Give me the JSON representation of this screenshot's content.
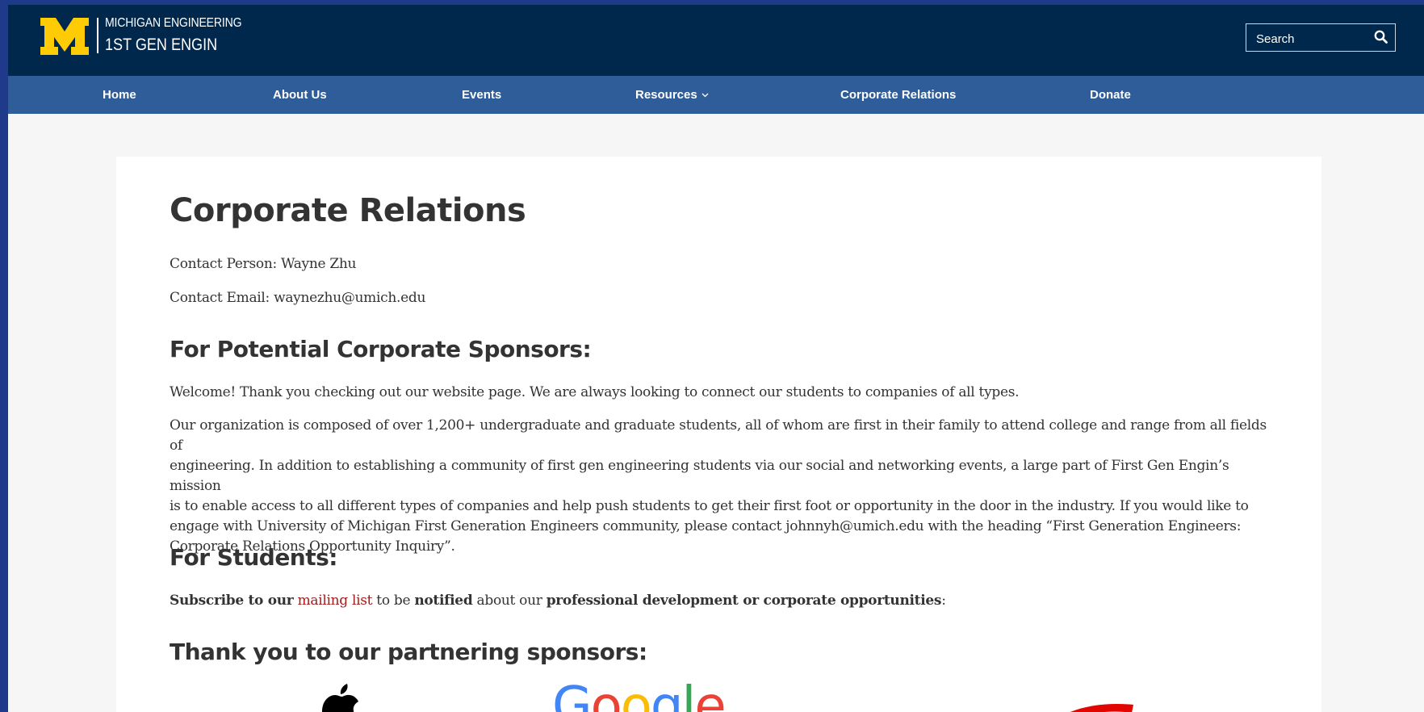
{
  "header": {
    "logo_top": "MICHIGAN ENGINEERING",
    "logo_bottom": "1ST GEN ENGIN",
    "search_placeholder": "Search",
    "colors": {
      "header_bg": "#00274c",
      "maize": "#ffcb05",
      "nav_bg": "#2e5d99"
    }
  },
  "nav": {
    "items": [
      {
        "label": "Home"
      },
      {
        "label": "About Us"
      },
      {
        "label": "Events"
      },
      {
        "label": "Resources"
      },
      {
        "label": "Corporate Relations"
      },
      {
        "label": "Donate"
      }
    ]
  },
  "page": {
    "title": "Corporate Relations",
    "contact_person": "Contact Person: Wayne Zhu",
    "contact_email": "Contact Email: waynezhu@umich.edu",
    "sponsors_heading": "For Potential Corporate Sponsors:",
    "welcome": "Welcome! Thank you checking out our website page. We are always looking to connect our students to companies of all types.",
    "org_lines": [
      "Our organization is composed of over 1,200+ undergraduate and graduate students, all of whom are first in their family to attend college and range from all fields of",
      "engineering. In addition to establishing a community of first gen engineering students via our social and networking events, a large part of First Gen Engin’s mission",
      "is to enable access to all different types of companies and help push students to get their first foot or opportunity in the door in the industry.  If you would like to",
      "engage with University of Michigan First Generation Engineers community, please contact johnnyh@umich.edu with the heading “First Generation Engineers:",
      "Corporate Relations Opportunity Inquiry”."
    ],
    "students_heading": "For Students:",
    "subscribe": {
      "part1": "Subscribe to our",
      "link": "mailing list",
      "part2": " to be ",
      "part3": "notified",
      "part4": " about our ",
      "part5": "professional development or corporate opportunities",
      "part6": ":"
    },
    "partners_heading": "Thank you to our partnering sponsors:",
    "sponsors": [
      "apple-logo",
      "google-logo",
      "red-swoosh-logo"
    ],
    "google_letters": [
      "G",
      "o",
      "o",
      "g",
      "l",
      "e"
    ],
    "google_colors": [
      "#4285f4",
      "#ea4335",
      "#fbbc05",
      "#4285f4",
      "#34a853",
      "#ea4335"
    ]
  }
}
